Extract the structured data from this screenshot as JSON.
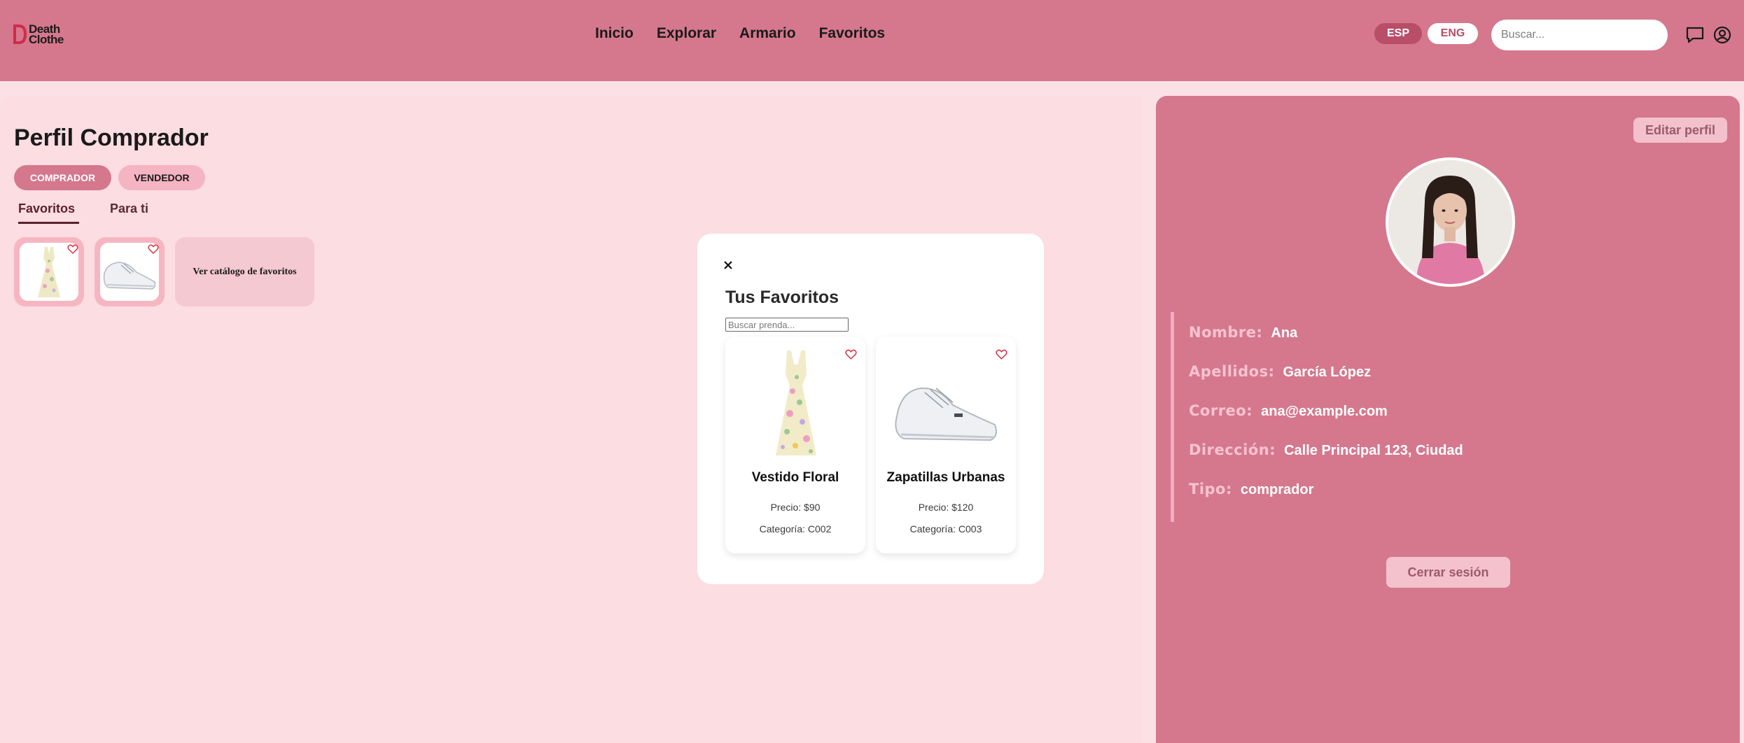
{
  "brand": {
    "line1": "Death",
    "line2": "Clothe"
  },
  "nav": {
    "items": [
      "Inicio",
      "Explorar",
      "Armario",
      "Favoritos"
    ]
  },
  "language": {
    "esp": "ESP",
    "eng": "ENG",
    "active": "ESP"
  },
  "search": {
    "placeholder": "Buscar..."
  },
  "profile": {
    "title": "Perfil Comprador",
    "roles": {
      "buyer": "COMPRADOR",
      "seller": "VENDEDOR",
      "active": "COMPRADOR"
    },
    "tabs": {
      "favorites": "Favoritos",
      "for_you": "Para ti",
      "active": "Favoritos"
    },
    "catalog_link": "Ver catálogo de favoritos"
  },
  "modal": {
    "title": "Tus Favoritos",
    "search_placeholder": "Buscar prenda...",
    "products": [
      {
        "name": "Vestido Floral",
        "price": "Precio: $90",
        "category": "Categoría: C002"
      },
      {
        "name": "Zapatillas Urbanas",
        "price": "Precio: $120",
        "category": "Categoría: C003"
      }
    ]
  },
  "user": {
    "edit_label": "Editar perfil",
    "fields": [
      {
        "label": "Nombre:",
        "value": "Ana"
      },
      {
        "label": "Apellidos:",
        "value": "García López"
      },
      {
        "label": "Correo:",
        "value": "ana@example.com"
      },
      {
        "label": "Dirección:",
        "value": "Calle Principal 123, Ciudad"
      },
      {
        "label": "Tipo:",
        "value": "comprador"
      }
    ],
    "logout_label": "Cerrar sesión"
  },
  "icons": {
    "logo": "logo-d-icon",
    "chat": "chat-bubble-icon",
    "account": "user-circle-icon",
    "heart": "heart-outline-icon",
    "close": "close-icon"
  },
  "colors": {
    "header": "#d5788d",
    "page": "#fbe1e5",
    "accent_dark": "#b94e68",
    "heart": "#d62d3d"
  }
}
